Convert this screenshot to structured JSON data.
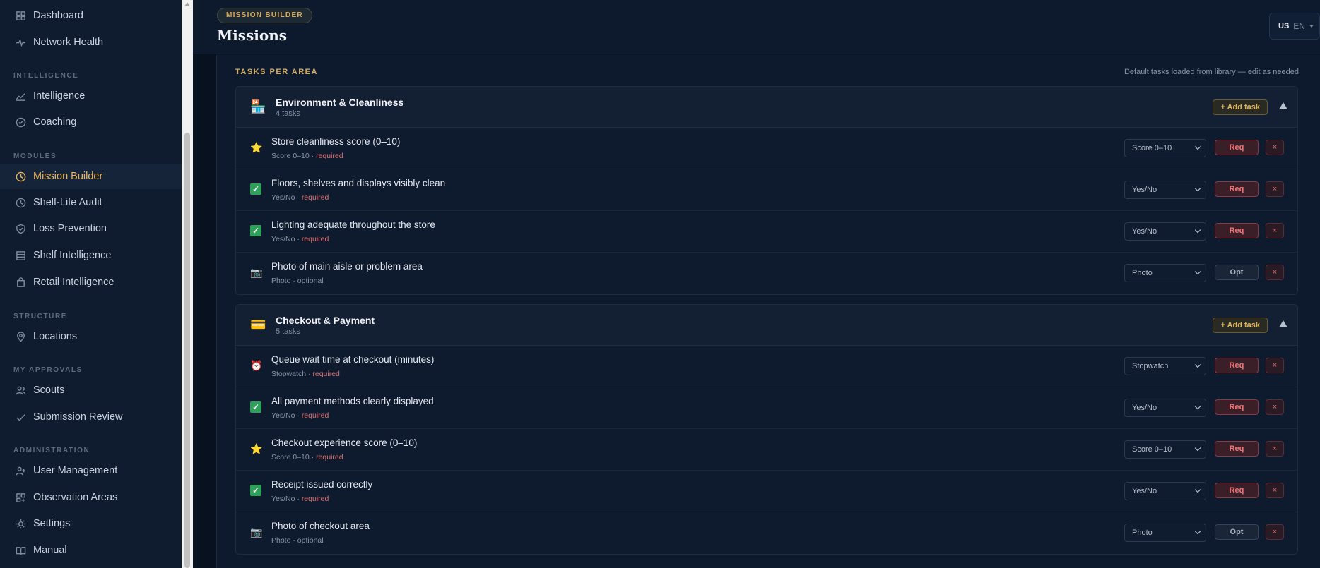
{
  "sidebar": {
    "top_items": [
      {
        "label": "Dashboard",
        "icon": "grid-icon"
      },
      {
        "label": "Network Health",
        "icon": "pulse-icon"
      }
    ],
    "sections": [
      {
        "title": "INTELLIGENCE",
        "items": [
          {
            "label": "Intelligence",
            "icon": "chart-line-icon"
          },
          {
            "label": "Coaching",
            "icon": "check-circle-icon"
          }
        ]
      },
      {
        "title": "MODULES",
        "items": [
          {
            "label": "Mission Builder",
            "icon": "clock-icon",
            "active": true
          },
          {
            "label": "Shelf-Life Audit",
            "icon": "clock-icon"
          },
          {
            "label": "Loss Prevention",
            "icon": "shield-icon"
          },
          {
            "label": "Shelf Intelligence",
            "icon": "shelves-icon"
          },
          {
            "label": "Retail Intelligence",
            "icon": "bag-icon"
          }
        ]
      },
      {
        "title": "STRUCTURE",
        "items": [
          {
            "label": "Locations",
            "icon": "pin-icon"
          }
        ]
      },
      {
        "title": "MY APPROVALS",
        "items": [
          {
            "label": "Scouts",
            "icon": "users-icon"
          },
          {
            "label": "Submission Review",
            "icon": "check-icon"
          }
        ]
      },
      {
        "title": "ADMINISTRATION",
        "items": [
          {
            "label": "User Management",
            "icon": "user-plus-icon"
          },
          {
            "label": "Observation Areas",
            "icon": "grid-plus-icon"
          },
          {
            "label": "Settings",
            "icon": "sun-icon"
          },
          {
            "label": "Manual",
            "icon": "book-icon"
          }
        ]
      }
    ]
  },
  "header": {
    "badge": "MISSION BUILDER",
    "title": "Missions",
    "lang_flag": "US",
    "lang_code": "EN"
  },
  "tasks_section": {
    "label": "TASKS PER AREA",
    "note": "Default tasks loaded from library — edit as needed",
    "add_task_label": "+ Add task",
    "areas": [
      {
        "icon": "store-icon",
        "icon_glyph": "🏪",
        "title": "Environment & Cleanliness",
        "count": "4 tasks",
        "tasks": [
          {
            "icon": "star-icon",
            "glyph": "⭐",
            "title": "Store cleanliness score (0–10)",
            "meta_type": "Score 0–10",
            "meta_req": "required",
            "select": "Score 0–10",
            "toggle": "Req"
          },
          {
            "icon": "checkbox-icon",
            "glyph": "✓",
            "title": "Floors, shelves and displays visibly clean",
            "meta_type": "Yes/No",
            "meta_req": "required",
            "select": "Yes/No",
            "toggle": "Req"
          },
          {
            "icon": "checkbox-icon",
            "glyph": "✓",
            "title": "Lighting adequate throughout the store",
            "meta_type": "Yes/No",
            "meta_req": "required",
            "select": "Yes/No",
            "toggle": "Req"
          },
          {
            "icon": "camera-icon",
            "glyph": "📷",
            "title": "Photo of main aisle or problem area",
            "meta_type": "Photo",
            "meta_req": "optional",
            "select": "Photo",
            "toggle": "Opt"
          }
        ]
      },
      {
        "icon": "credit-card-icon",
        "icon_glyph": "💳",
        "title": "Checkout & Payment",
        "count": "5 tasks",
        "tasks": [
          {
            "icon": "alarm-clock-icon",
            "glyph": "⏰",
            "title": "Queue wait time at checkout (minutes)",
            "meta_type": "Stopwatch",
            "meta_req": "required",
            "select": "Stopwatch",
            "toggle": "Req"
          },
          {
            "icon": "checkbox-icon",
            "glyph": "✓",
            "title": "All payment methods clearly displayed",
            "meta_type": "Yes/No",
            "meta_req": "required",
            "select": "Yes/No",
            "toggle": "Req"
          },
          {
            "icon": "star-icon",
            "glyph": "⭐",
            "title": "Checkout experience score (0–10)",
            "meta_type": "Score 0–10",
            "meta_req": "required",
            "select": "Score 0–10",
            "toggle": "Req"
          },
          {
            "icon": "checkbox-icon",
            "glyph": "✓",
            "title": "Receipt issued correctly",
            "meta_type": "Yes/No",
            "meta_req": "required",
            "select": "Yes/No",
            "toggle": "Req"
          },
          {
            "icon": "camera-icon",
            "glyph": "📷",
            "title": "Photo of checkout area",
            "meta_type": "Photo",
            "meta_req": "optional",
            "select": "Photo",
            "toggle": "Opt"
          }
        ]
      }
    ]
  },
  "colors": {
    "accent": "#e8b55c",
    "required": "#e07070",
    "background": "#0d1a2e"
  }
}
